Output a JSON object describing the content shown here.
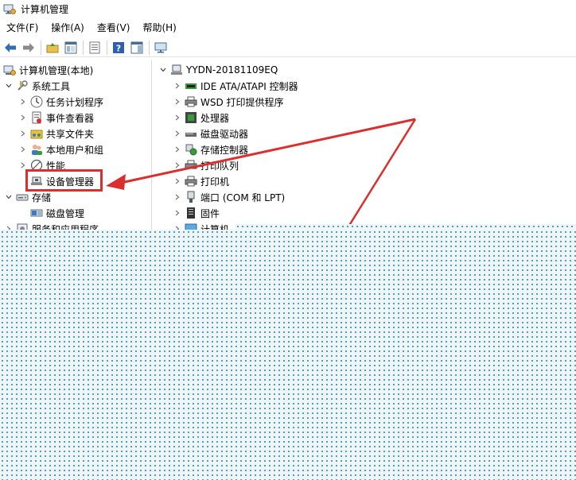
{
  "window": {
    "title": "计算机管理"
  },
  "menu": [
    "文件(F)",
    "操作(A)",
    "查看(V)",
    "帮助(H)"
  ],
  "toolbar": {
    "icons": [
      "back-icon",
      "forward-icon",
      "up-folder-icon",
      "show-hide-tree-icon",
      "properties-icon",
      "help-icon",
      "show-action-pane-icon",
      "monitor-icon"
    ]
  },
  "left_tree": {
    "root": "计算机管理(本地)",
    "system_tools": "系统工具",
    "task_scheduler": "任务计划程序",
    "event_viewer": "事件查看器",
    "shared_folders": "共享文件夹",
    "local_users": "本地用户和组",
    "performance": "性能",
    "device_manager": "设备管理器",
    "storage": "存储",
    "disk_management": "磁盘管理",
    "services_apps": "服务和应用程序"
  },
  "device_tree": {
    "computer": "YYDN-20181109EQ",
    "categories": [
      "IDE ATA/ATAPI 控制器",
      "WSD 打印提供程序",
      "处理器",
      "磁盘驱动器",
      "存储控制器",
      "打印队列",
      "打印机",
      "端口 (COM 和 LPT)",
      "固件",
      "计算机"
    ]
  },
  "colors": {
    "annotation": "#d9302f",
    "pattern_dot": "#3f97b7"
  }
}
